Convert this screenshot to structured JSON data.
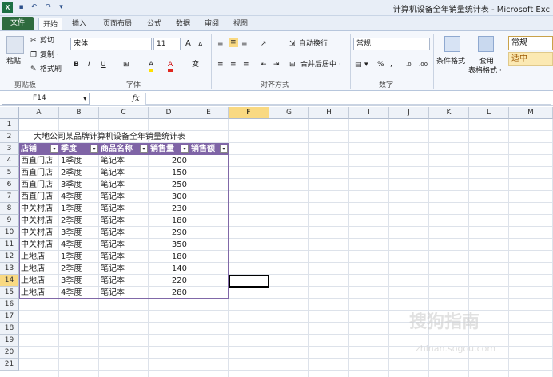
{
  "titlebar": {
    "app_icon": "X",
    "title": "计算机设备全年销量统计表 - Microsoft Exc"
  },
  "tabs": [
    "文件",
    "开始",
    "插入",
    "页面布局",
    "公式",
    "数据",
    "审阅",
    "视图"
  ],
  "ribbon": {
    "clipboard": {
      "paste": "粘贴",
      "cut": "剪切",
      "copy": "复制 ·",
      "format_painter": "格式刷",
      "label": "剪贴板"
    },
    "font": {
      "name": "宋体",
      "size": "11",
      "label": "字体",
      "bold": "B",
      "italic": "I",
      "underline": "U",
      "grow": "A",
      "shrink": "A",
      "fill": "A",
      "color": "A",
      "wen": "变"
    },
    "align": {
      "wrap": "自动换行",
      "merge": "合并后居中 ·",
      "label": "对齐方式"
    },
    "number": {
      "format": "常规",
      "percent": "%",
      "comma": ",",
      "label": "数字",
      "currency": "▾"
    },
    "styles": {
      "conditional": "条件格式",
      "table": "套用",
      "table2": "表格格式 ·",
      "normal": "常规",
      "neutral": "适中"
    }
  },
  "formula_bar": {
    "name_box": "F14",
    "fx": "fx",
    "content": ""
  },
  "columns": [
    "A",
    "B",
    "C",
    "D",
    "E",
    "F",
    "G",
    "H",
    "I",
    "J",
    "K",
    "L",
    "M"
  ],
  "selected_column": "F",
  "selected_row": 14,
  "rows": [
    1,
    2,
    3,
    4,
    5,
    6,
    7,
    8,
    9,
    10,
    11,
    12,
    13,
    14,
    15,
    16,
    17,
    18,
    19,
    20,
    21
  ],
  "sheet": {
    "title": "大地公司某品牌计算机设备全年销量统计表",
    "headers": [
      "店铺",
      "季度",
      "商品名称",
      "销售量",
      "销售额"
    ],
    "data": [
      [
        "西直门店",
        "1季度",
        "笔记本",
        "200",
        ""
      ],
      [
        "西直门店",
        "2季度",
        "笔记本",
        "150",
        ""
      ],
      [
        "西直门店",
        "3季度",
        "笔记本",
        "250",
        ""
      ],
      [
        "西直门店",
        "4季度",
        "笔记本",
        "300",
        ""
      ],
      [
        "中关村店",
        "1季度",
        "笔记本",
        "230",
        ""
      ],
      [
        "中关村店",
        "2季度",
        "笔记本",
        "180",
        ""
      ],
      [
        "中关村店",
        "3季度",
        "笔记本",
        "290",
        ""
      ],
      [
        "中关村店",
        "4季度",
        "笔记本",
        "350",
        ""
      ],
      [
        "上地店",
        "1季度",
        "笔记本",
        "180",
        ""
      ],
      [
        "上地店",
        "2季度",
        "笔记本",
        "140",
        ""
      ],
      [
        "上地店",
        "3季度",
        "笔记本",
        "220",
        ""
      ],
      [
        "上地店",
        "4季度",
        "笔记本",
        "280",
        ""
      ]
    ]
  },
  "watermark": {
    "text": "搜狗指南",
    "sub": "zhinan.sogou.com"
  },
  "colors": {
    "header_bg": "#7f64a6",
    "selected_header": "#f9d982",
    "file_tab": "#2e6b3e"
  }
}
